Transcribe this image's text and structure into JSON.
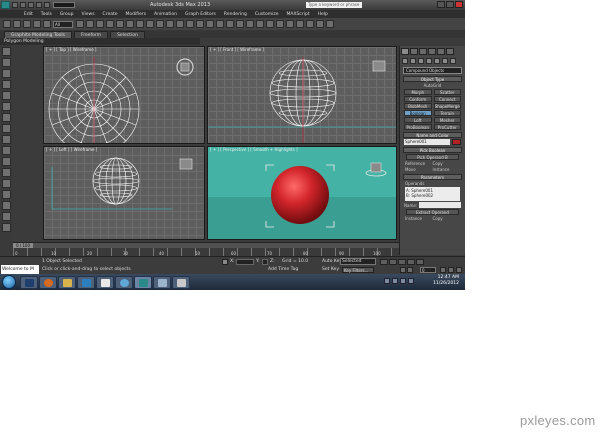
{
  "app": {
    "title": "Autodesk 3ds Max 2013",
    "search_placeholder": "Type a keyword or phrase"
  },
  "menu": [
    "Edit",
    "Tools",
    "Group",
    "Views",
    "Create",
    "Modifiers",
    "Animation",
    "Graph Editors",
    "Rendering",
    "Customize",
    "MAXScript",
    "Help"
  ],
  "toolbar": {
    "selection_filter": "All"
  },
  "ribbon": {
    "tabs": [
      "Graphite Modeling Tools",
      "Freeform",
      "Selection"
    ],
    "sub_label": "Polygon Modeling"
  },
  "viewports": {
    "top": "[ + ] [ Top ] [ Wireframe ]",
    "front": "[ + ] [ Front ] [ Wireframe ]",
    "left": "[ + ] [ Left ] [ Wireframe ]",
    "perspective": "[ + ] [ Perspective ] [ Smooth + Highlights ]"
  },
  "command_panel": {
    "category": "Compound Objects",
    "object_type_title": "Object Type",
    "autogrid": "AutoGrid",
    "object_types": [
      "Morph",
      "Scatter",
      "Conform",
      "Connect",
      "BlobMesh",
      "ShapeMerge",
      "Boolean",
      "Terrain",
      "Loft",
      "Mesher",
      "ProBoolean",
      "ProCutter"
    ],
    "active_type": "Boolean",
    "name_color_title": "Name and Color",
    "object_name": "Sphere001",
    "object_color": "#b21f24",
    "pick_boolean_title": "Pick Boolean",
    "pick_operand_button": "Pick Operand B",
    "reference_label": "Reference",
    "copy_label": "Copy",
    "move_label": "Move",
    "instance_label": "Instance",
    "parameters_title": "Parameters",
    "operands_label": "Operands",
    "operands": [
      "A: Sphere001",
      "B: Sphere002"
    ],
    "name_label": "Name:",
    "extract_operand": "Extract Operand",
    "extract_instance": "Instance",
    "extract_copy": "Copy"
  },
  "timeline": {
    "slider": "0 / 100",
    "ticks": [
      "0",
      "10",
      "20",
      "30",
      "40",
      "50",
      "60",
      "70",
      "80",
      "90",
      "100"
    ]
  },
  "statusbar": {
    "maxscript": "Welcome to M",
    "object_status": "1 Object Selected",
    "hint": "Click or click-and-drag to select objects",
    "x_label": "X:",
    "y_label": "Y:",
    "z_label": "Z:",
    "grid": "Grid = 10.0",
    "add_time_tag": "Add Time Tag",
    "auto_key": "Auto Key",
    "selection_dropdown": "Selected",
    "set_key": "Set Key",
    "key_filters": "Key Filters...",
    "frame": "0"
  },
  "taskbar": {
    "time": "12:47 AM",
    "date": "11/26/2012"
  },
  "watermark": "pxleyes.com"
}
